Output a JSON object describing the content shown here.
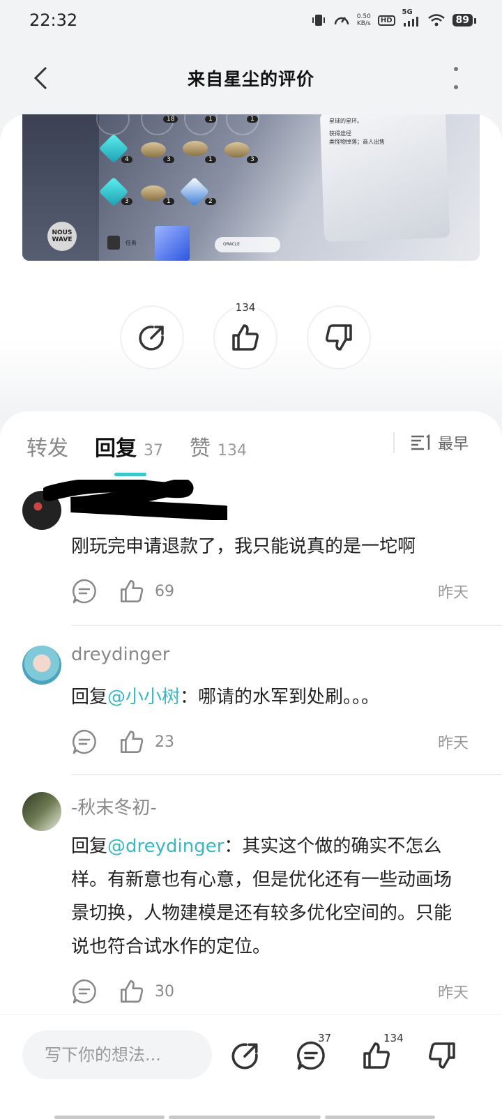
{
  "status_bar": {
    "time": "22:32",
    "net_speed_value": "0.50",
    "net_speed_unit": "KB/s",
    "hd_label": "HD",
    "network_label": "5G",
    "battery": "89"
  },
  "nav": {
    "title": "来自星尘的评价"
  },
  "post": {
    "image_texts": {
      "panel_line_1": "星球的星环。",
      "panel_line_2": "获得途径",
      "panel_line_3": "类怪物掉落；商人出售",
      "logo": "NOUS WAVE",
      "task": "任务",
      "oracle": "ORACLE",
      "counts": [
        "18",
        "1",
        "1",
        "4",
        "3",
        "1",
        "3",
        "3",
        "1",
        "2"
      ]
    },
    "like_count": "134"
  },
  "tabs": {
    "items": [
      {
        "label": "转发",
        "count": ""
      },
      {
        "label": "回复",
        "count": "37"
      },
      {
        "label": "赞",
        "count": "134"
      }
    ],
    "sort_label": "最早"
  },
  "comments": [
    {
      "username": "",
      "text": "刚玩完申请退款了，我只能说真的是一坨啊",
      "like_count": "69",
      "time": "昨天"
    },
    {
      "username": "dreydinger",
      "reply_prefix": "回复",
      "mention": "@小小树",
      "text": "：哪请的水军到处刷。。。",
      "like_count": "23",
      "time": "昨天"
    },
    {
      "username": "-秋末冬初-",
      "reply_prefix": "回复",
      "mention": "@dreydinger",
      "text": "：其实这个做的确实不怎么样。有新意也有心意，但是优化还有一些动画场景切换，人物建模是还有较多优化空间的。只能说也符合试水作的定位。",
      "like_count": "30",
      "time": "昨天"
    }
  ],
  "bottom_bar": {
    "input_placeholder": "写下你的想法...",
    "comment_count": "37",
    "like_count": "134"
  },
  "colors": {
    "accent": "#3cc6c6",
    "mention": "#3bb7c3",
    "background": "#f2f3f5"
  }
}
